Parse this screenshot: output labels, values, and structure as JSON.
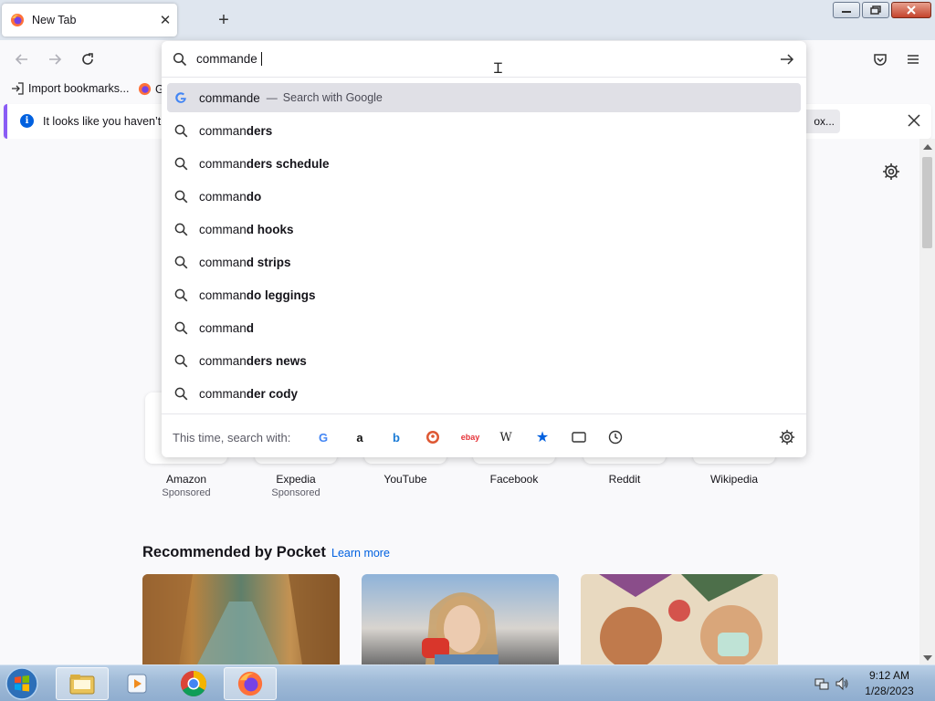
{
  "browser": {
    "tab": {
      "title": "New Tab",
      "icon": "firefox-icon"
    },
    "nav": {
      "back": "back-arrow-icon",
      "forward": "forward-arrow-icon",
      "reload": "reload-icon"
    }
  },
  "bookmarks": {
    "items": [
      {
        "label": "Import bookmarks...",
        "icon": "import-icon"
      },
      {
        "label": "G",
        "icon": "firefox-icon"
      }
    ]
  },
  "notification": {
    "text": "It looks like you haven’t s",
    "button_label": "ox..."
  },
  "urlbar": {
    "value": "commande",
    "suggestions": [
      {
        "typed": "commande",
        "rest": "",
        "dash": "—",
        "action": "Search with Google",
        "icon": "google-icon",
        "selected": true
      },
      {
        "typed": "comman",
        "rest": "ders",
        "icon": "search-icon"
      },
      {
        "typed": "comman",
        "rest": "ders schedule",
        "icon": "search-icon"
      },
      {
        "typed": "comman",
        "rest": "do",
        "icon": "search-icon"
      },
      {
        "typed": "comman",
        "rest": "d hooks",
        "icon": "search-icon"
      },
      {
        "typed": "comman",
        "rest": "d strips",
        "icon": "search-icon"
      },
      {
        "typed": "comman",
        "rest": "do leggings",
        "icon": "search-icon"
      },
      {
        "typed": "comman",
        "rest": "d",
        "icon": "search-icon"
      },
      {
        "typed": "comman",
        "rest": "ders news",
        "icon": "search-icon"
      },
      {
        "typed": "comman",
        "rest": "der cody",
        "icon": "search-icon"
      }
    ],
    "oneoff_label": "This time, search with:",
    "engines": [
      {
        "name": "google",
        "glyph": "G",
        "color": "#4285f4"
      },
      {
        "name": "amazon",
        "glyph": "a",
        "color": "#111111"
      },
      {
        "name": "bing",
        "glyph": "b",
        "color": "#1a7bd6"
      },
      {
        "name": "duckduckgo",
        "glyph": "D",
        "color": "#de5833"
      },
      {
        "name": "ebay",
        "glyph": "ebay",
        "color": "#e53238"
      },
      {
        "name": "wikipedia",
        "glyph": "W",
        "color": "#222222"
      },
      {
        "name": "bookmarks",
        "glyph": "★",
        "color": "#0060df"
      },
      {
        "name": "tabs",
        "glyph": "tabs-icon",
        "color": "#333333"
      },
      {
        "name": "history",
        "glyph": "clock-icon",
        "color": "#333333"
      }
    ]
  },
  "top_sites": [
    {
      "name": "Amazon",
      "sponsored": "Sponsored"
    },
    {
      "name": "Expedia",
      "sponsored": "Sponsored"
    },
    {
      "name": "YouTube"
    },
    {
      "name": "Facebook"
    },
    {
      "name": "Reddit"
    },
    {
      "name": "Wikipedia"
    }
  ],
  "pocket": {
    "title": "Recommended by Pocket",
    "learn_more": "Learn more"
  },
  "taskbar": {
    "time": "9:12 AM",
    "date": "1/28/2023"
  },
  "colors": {
    "accent": "#0060df",
    "notification_border": "#8a5cf5",
    "taskbar": "#9fbad7"
  }
}
